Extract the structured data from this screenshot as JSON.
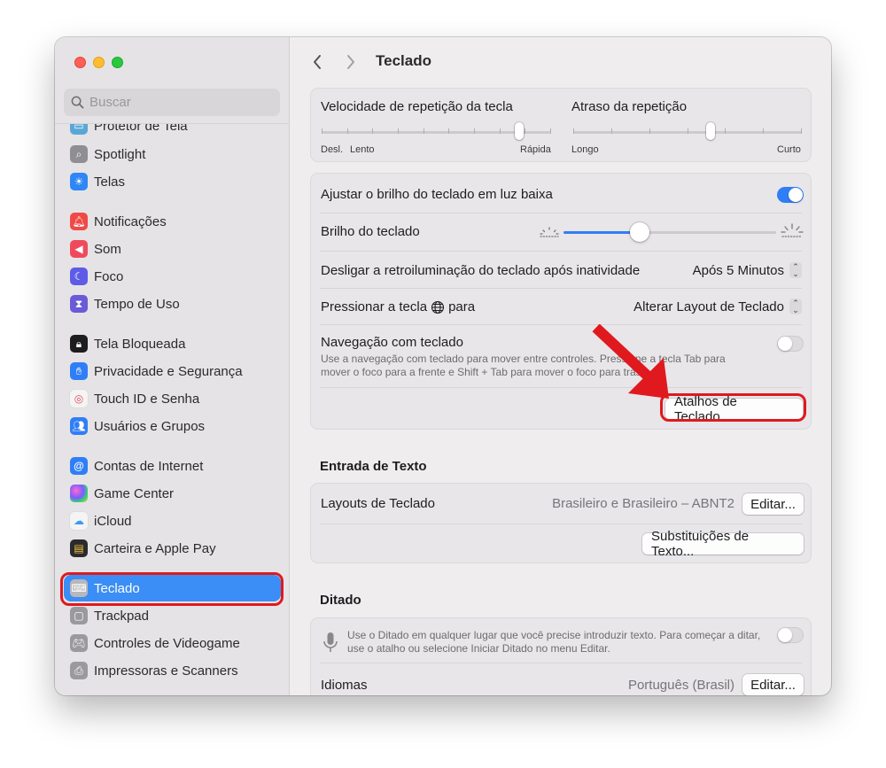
{
  "sidebar": {
    "search_placeholder": "Buscar",
    "items": [
      {
        "label": "Protetor de Tela",
        "icon": "screensaver-icon",
        "color": "#5aa7d6"
      },
      {
        "label": "Spotlight",
        "icon": "magnifier-icon",
        "color": "#8e8e93"
      },
      {
        "label": "Telas",
        "icon": "sun-icon",
        "color": "#2f86f5"
      },
      {
        "label": "Notificações",
        "icon": "bell-icon",
        "color": "#ef4a46"
      },
      {
        "label": "Som",
        "icon": "speaker-icon",
        "color": "#ef4a5c"
      },
      {
        "label": "Foco",
        "icon": "moon-icon",
        "color": "#5e5ce6"
      },
      {
        "label": "Tempo de Uso",
        "icon": "hourglass-icon",
        "color": "#6a5ad8"
      },
      {
        "label": "Tela Bloqueada",
        "icon": "lock-icon",
        "color": "#1d1d1f"
      },
      {
        "label": "Privacidade e Segurança",
        "icon": "hand-icon",
        "color": "#2f7ef6"
      },
      {
        "label": "Touch ID e Senha",
        "icon": "fingerprint-icon",
        "color": "#f4f4f4"
      },
      {
        "label": "Usuários e Grupos",
        "icon": "users-icon",
        "color": "#2f7ef6"
      },
      {
        "label": "Contas de Internet",
        "icon": "at-icon",
        "color": "#2f7ef6"
      },
      {
        "label": "Game Center",
        "icon": "game-center-icon",
        "color": "#f4f4f4"
      },
      {
        "label": "iCloud",
        "icon": "cloud-icon",
        "color": "#f4f4f4"
      },
      {
        "label": "Carteira e Apple Pay",
        "icon": "wallet-icon",
        "color": "#2b2b2d"
      },
      {
        "label": "Teclado",
        "icon": "keyboard-icon",
        "color": "#9a9a9e"
      },
      {
        "label": "Trackpad",
        "icon": "trackpad-icon",
        "color": "#9a9a9e"
      },
      {
        "label": "Controles de Videogame",
        "icon": "gamepad-icon",
        "color": "#9a9a9e"
      },
      {
        "label": "Impressoras e Scanners",
        "icon": "printer-icon",
        "color": "#9a9a9e"
      }
    ]
  },
  "header": {
    "title": "Teclado"
  },
  "key_repeat": {
    "repeat_label": "Velocidade de repetição da tecla",
    "repeat_min": "Desl.",
    "repeat_slow": "Lento",
    "repeat_max": "Rápida",
    "repeat_value": 0.86,
    "delay_label": "Atraso da repetição",
    "delay_min": "Longo",
    "delay_max": "Curto",
    "delay_value": 0.6
  },
  "backlight": {
    "adjust_label": "Ajustar o brilho do teclado em luz baixa",
    "adjust_on": true,
    "brightness_label": "Brilho do teclado",
    "brightness_value": 0.36,
    "off_label": "Desligar a retroiluminação do teclado após inatividade",
    "off_value": "Após 5 Minutos",
    "globe_label_before": "Pressionar a tecla",
    "globe_label_after": "para",
    "globe_value": "Alterar Layout de Teclado",
    "nav_label": "Navegação com teclado",
    "nav_on": false,
    "nav_desc_1": "Use a navegação com teclado para mover entre controles. Pressione a tecla Tab para",
    "nav_desc_2": "mover o foco para a frente e Shift + Tab para mover o foco para trás.",
    "shortcuts_button": "Atalhos de Teclado..."
  },
  "text_input": {
    "section_title": "Entrada de Texto",
    "layouts_label": "Layouts de Teclado",
    "layouts_value": "Brasileiro e Brasileiro – ABNT2",
    "edit_button": "Editar...",
    "substitutions_button": "Substituições de Texto..."
  },
  "dictation": {
    "section_title": "Ditado",
    "desc_1": "Use o Ditado em qualquer lugar que você precise introduzir texto. Para começar a ditar,",
    "desc_2": "use o atalho ou selecione Iniciar Ditado no menu Editar.",
    "dictation_on": false,
    "languages_label": "Idiomas",
    "languages_value": "Português (Brasil)",
    "edit_button": "Editar..."
  },
  "colors": {
    "accent": "#3a8ef5",
    "annotation_red": "#e0191e"
  }
}
